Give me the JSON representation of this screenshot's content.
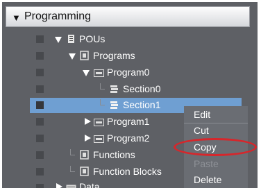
{
  "header": {
    "title": "Programming"
  },
  "tree": {
    "pous": "POUs",
    "programs": "Programs",
    "program0": "Program0",
    "section0": "Section0",
    "section1": "Section1",
    "program1": "Program1",
    "program2": "Program2",
    "functions": "Functions",
    "function_blocks": "Function Blocks",
    "data": "Data"
  },
  "context_menu": {
    "edit": "Edit",
    "cut": "Cut",
    "copy": "Copy",
    "paste": "Paste",
    "delete": "Delete"
  },
  "colors": {
    "panel_bg": "#5e6065",
    "selection": "#6f9fd2",
    "menu_bg": "#6a6d73",
    "annotation": "#d7262b"
  }
}
